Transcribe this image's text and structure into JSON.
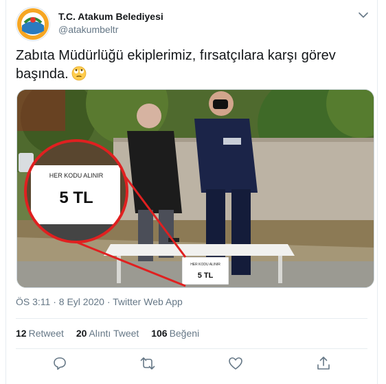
{
  "account": {
    "display_name": "T.C. Atakum Belediyesi",
    "handle": "@atakumbeltr"
  },
  "tweet": {
    "text_line1": "Zabıta Müdürlüğü ekiplerimiz, fırsatçılara karşı görev",
    "text_line2": "başında.",
    "timestamp": "ÖS 3:11 · 8 Eyl 2020 · Twitter Web App"
  },
  "photo": {
    "sign_line1": "HER KODU ALINIR",
    "sign_line2": "5 TL"
  },
  "stats": {
    "retweets_count": "12",
    "retweets_label": "Retweet",
    "quotes_count": "20",
    "quotes_label": "Alıntı Tweet",
    "likes_count": "106",
    "likes_label": "Beğeni"
  },
  "icons": {
    "reply": "reply-icon",
    "retweet": "retweet-icon",
    "like": "heart-icon",
    "share": "share-icon",
    "more": "chevron-down-icon",
    "emoji": "rolling-eyes-emoji"
  },
  "colors": {
    "text": "#14171a",
    "secondary": "#657786",
    "border": "#e6ecf0"
  }
}
